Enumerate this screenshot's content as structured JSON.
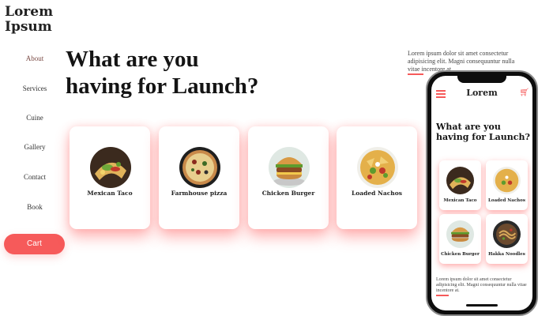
{
  "brand": {
    "line1": "Lorem",
    "line2": "Ipsum"
  },
  "nav": {
    "items": [
      {
        "label": "About",
        "active": true
      },
      {
        "label": "Services"
      },
      {
        "label": "Cuine"
      },
      {
        "label": "Gallery"
      },
      {
        "label": "Contact"
      },
      {
        "label": "Book"
      }
    ],
    "cart_label": "Cart"
  },
  "main": {
    "headline_line1": "What are you",
    "headline_line2": "having for Launch?",
    "cards": [
      {
        "label": "Mexican Taco",
        "icon": "taco-image"
      },
      {
        "label": "Farmhouse pizza",
        "icon": "pizza-image"
      },
      {
        "label": "Chicken Burger",
        "icon": "burger-image"
      },
      {
        "label": "Loaded Nachos",
        "icon": "nachos-image"
      }
    ]
  },
  "side_text": "Lorem ipsum dolor sit amet consectetur adipisicing elit. Magni consequuntur nulla vitae incentore at.",
  "mobile": {
    "logo": "Lorem",
    "headline_line1": "What are you",
    "headline_line2": "having for Launch?",
    "cards": [
      {
        "label": "Mexican Taco"
      },
      {
        "label": "Loaded Nachos"
      },
      {
        "label": "Chicken Burger"
      },
      {
        "label": "Hakka Noodles"
      }
    ],
    "text": "Lorem ipsum dolor sit amet consectetur adipisicing elit. Magni consequuntur nulla vitae incentore at."
  },
  "colors": {
    "accent": "#f65a5a",
    "text": "#1a1a1a",
    "phone": "#0d0d0d"
  }
}
